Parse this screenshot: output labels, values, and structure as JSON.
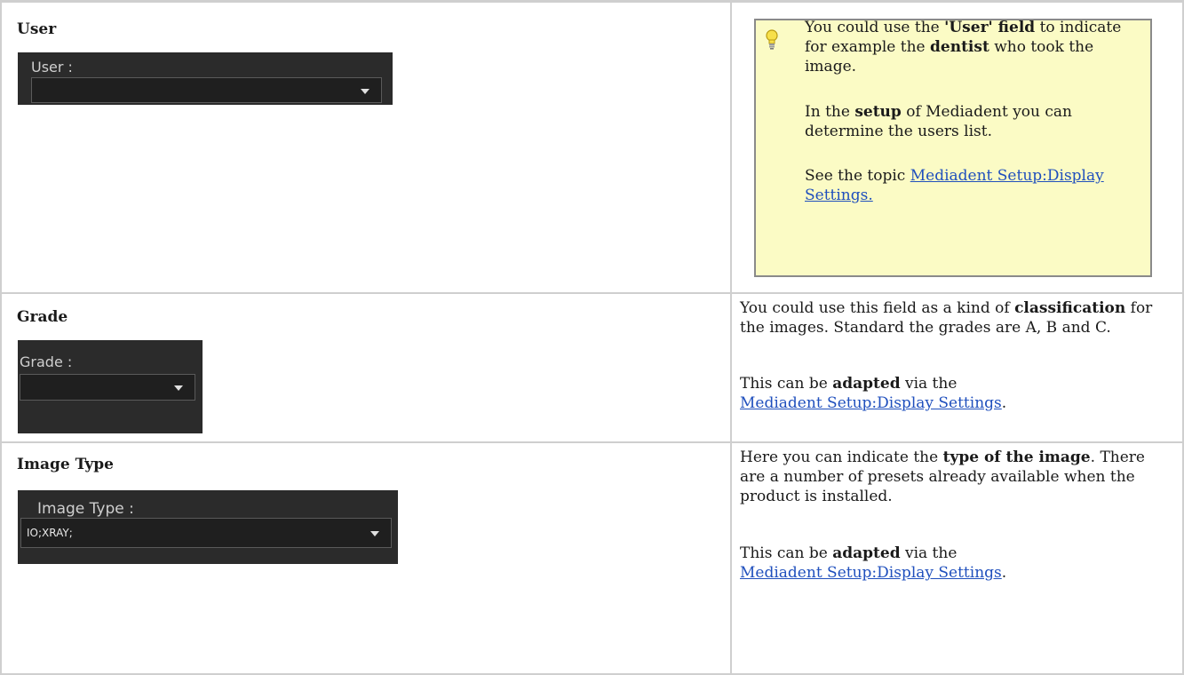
{
  "rows": [
    {
      "title": "User",
      "widget": {
        "label": "User :",
        "value": ""
      },
      "tip": {
        "p1_a": "You could use the ",
        "p1_b": "'User' field",
        "p1_c": " to indicate for example the ",
        "p1_d": "dentist",
        "p1_e": " who took the image.",
        "p2_a": "In the ",
        "p2_b": "setup",
        "p2_c": " of Mediadent you can determine the users list.",
        "p3_a": "See the topic ",
        "p3_link": "Mediadent Setup:Display Settings."
      }
    },
    {
      "title": "Grade",
      "widget": {
        "label": "Grade :",
        "value": ""
      },
      "desc": {
        "p1_a": "You could use this field as a kind of ",
        "p1_b": "classification",
        "p1_c": " for the images. Standard the grades are A, B and C.",
        "p2_a": "This can be ",
        "p2_b": "adapted",
        "p2_c": " via the ",
        "p2_link": "Mediadent Setup:Display Settings",
        "p2_d": "."
      }
    },
    {
      "title": "Image Type",
      "widget": {
        "label": "Image Type :",
        "value": "IO;XRAY;"
      },
      "desc": {
        "p1_a": "Here you can indicate the ",
        "p1_b": "type of the image",
        "p1_c": ". There are a number of presets already available when the product is installed.",
        "p2_a": "This can be ",
        "p2_b": "adapted",
        "p2_c": " via the ",
        "p2_link": "Mediadent Setup:Display Settings",
        "p2_d": "."
      }
    }
  ],
  "colors": {
    "tip_background": "#fbfbc5",
    "link": "#1f4fbd",
    "widget_background": "#2b2b2b"
  },
  "icons": {
    "tip": "lightbulb-icon",
    "combo": "chevron-down-icon"
  }
}
